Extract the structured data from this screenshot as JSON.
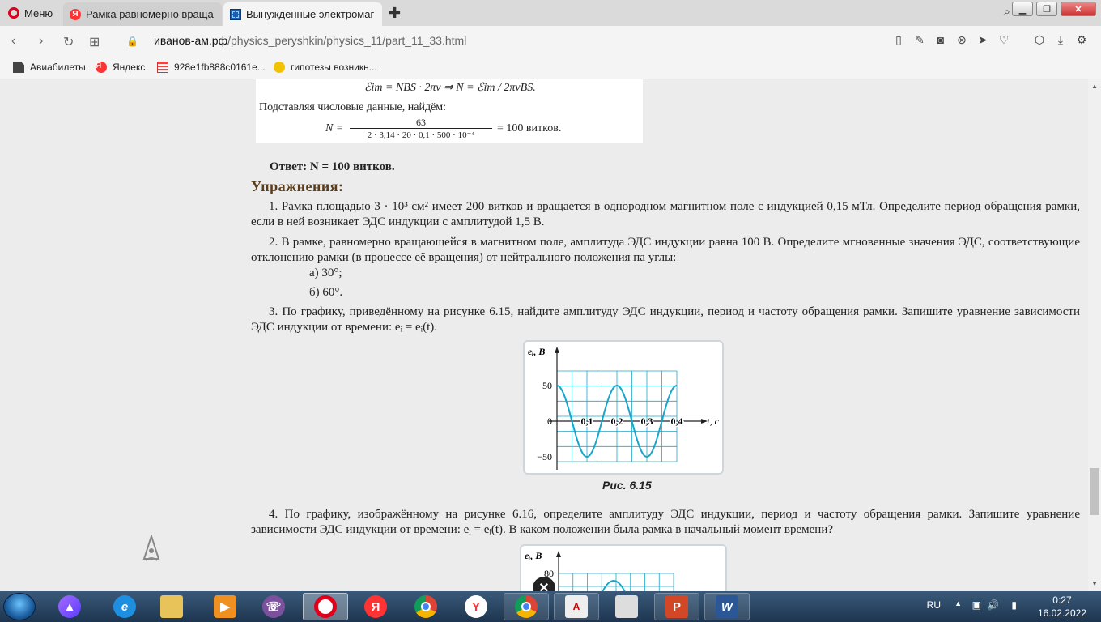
{
  "browser": {
    "menu_label": "Меню",
    "tabs": [
      {
        "label": "Рамка равномерно враща",
        "state": "inactive"
      },
      {
        "label": "Вынужденные электромаг",
        "state": "active"
      }
    ],
    "url_host": "иванов-ам.рф",
    "url_path": "/physics_peryshkin/physics_11/part_11_33.html",
    "bookmarks": [
      {
        "label": "Авиабилеты"
      },
      {
        "label": "Яндекс"
      },
      {
        "label": "928e1fb888c0161e..."
      },
      {
        "label": "гипотезы возникн..."
      }
    ]
  },
  "page": {
    "scan": {
      "formula_line1": "ℰim = NBS · 2πν ⇒ N = ℰim / 2πνBS.",
      "subst_text": "Подставляя числовые данные, найдём:",
      "n_label": "N =",
      "numerator": "63",
      "denominator": "2 · 3,14 · 20 · 0,1 · 500 · 10⁻⁴",
      "result": "= 100 витков."
    },
    "answer": "Ответ: N = 100 витков.",
    "exercises_title": "Упражнения:",
    "ex1": "1. Рамка площадью 3 · 10³ см² имеет 200 витков и вращается в однородном магнитном поле с индукцией 0,15 мТл. Определите период обращения рамки, если в ней возникает ЭДС индукции с амплитудой 1,5 В.",
    "ex2": "2. В рамке, равномерно вращающейся в магнитном поле, амплитуда ЭДС индукции равна 100 В. Определите мгновенные значения ЭДС, соответствующие отклонению рамки (в процессе её вращения) от нейтрального положения па углы:",
    "ex2a": "а) 30°;",
    "ex2b": "б) 60°.",
    "ex3": "3. По графику, приведённому на рисунке 6.15, найдите амплитуду ЭДС индукции, период и частоту обращения рамки. Запишите уравнение зависимости ЭДС индукции от времени: eᵢ = eᵢ(t).",
    "fig1_caption": "Рис. 6.15",
    "ex4": "4. По графику, изображённому на рисунке 6.16, определите амплитуду ЭДС индукции, период и частоту обращения рамки. Запишите уравнение зависимости ЭДС индукции от времени: eᵢ = eᵢ(t). В каком положении была рамка в начальный момент времени?"
  },
  "chart_data": [
    {
      "type": "line",
      "title": "Рис. 6.15",
      "ylabel": "eᵢ, В",
      "xlabel": "t, c",
      "y_ticks": [
        "50",
        "0",
        "−50"
      ],
      "x_ticks": [
        "0,1",
        "0,2",
        "0,3",
        "0,4"
      ],
      "amplitude": 50,
      "period": 0.2,
      "function": "50·cos(2π·t/0,2)",
      "x": [
        0,
        0.05,
        0.1,
        0.15,
        0.2,
        0.25,
        0.3,
        0.35,
        0.4
      ],
      "y": [
        50,
        0,
        -50,
        0,
        50,
        0,
        -50,
        0,
        50
      ],
      "xlim": [
        0,
        0.4
      ],
      "ylim": [
        -50,
        50
      ],
      "grid": true,
      "color": "#1aa6c8"
    },
    {
      "type": "line",
      "title": "",
      "ylabel": "eᵢ, В",
      "y_ticks": [
        "80"
      ],
      "partial": true,
      "color": "#1aa6c8"
    }
  ],
  "taskbar": {
    "language": "RU",
    "time": "0:27",
    "date": "16.02.2022"
  }
}
